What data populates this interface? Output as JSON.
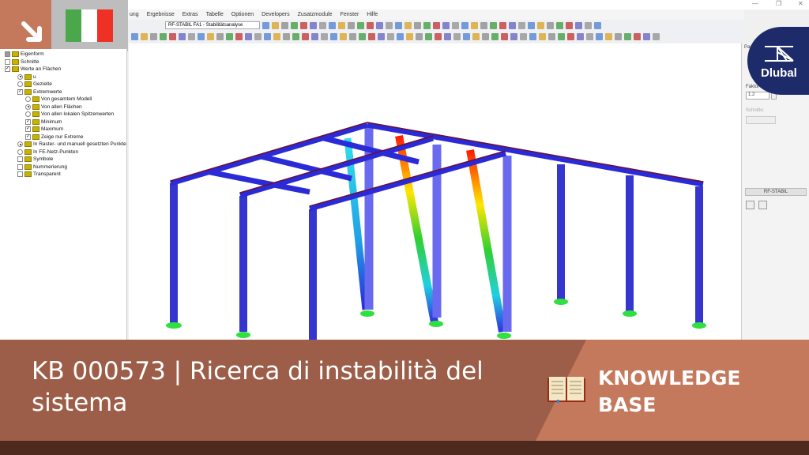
{
  "menu": [
    "ung",
    "Ergebnisse",
    "Extras",
    "Tabelle",
    "Optionen",
    "Developers",
    "Zusatzmodule",
    "Fenster",
    "Hilfe"
  ],
  "toolbar": {
    "case_select": "RF-STABIL FA1 - Stabilitätsanalyse"
  },
  "tree": [
    {
      "label": "Eigenform",
      "type": "cb",
      "state": "partial",
      "level": 0
    },
    {
      "label": "Schnitte",
      "type": "cb",
      "state": "off",
      "level": 0
    },
    {
      "label": "Werte an Flächen",
      "type": "cb",
      "state": "on",
      "level": 0
    },
    {
      "label": "u",
      "type": "rd",
      "state": "on",
      "level": 1
    },
    {
      "label": "Gezielte",
      "type": "rd",
      "state": "off",
      "level": 1
    },
    {
      "label": "Extremwerte",
      "type": "cb",
      "state": "on",
      "level": 1
    },
    {
      "label": "Von gesamtem Modell",
      "type": "rd",
      "state": "off",
      "level": 2
    },
    {
      "label": "Von allen Flächen",
      "type": "rd",
      "state": "on",
      "level": 2
    },
    {
      "label": "Von allen lokalen Spitzenwerten",
      "type": "rd",
      "state": "off",
      "level": 2
    },
    {
      "label": "Minimum",
      "type": "cb",
      "state": "on",
      "level": 2
    },
    {
      "label": "Maximum",
      "type": "cb",
      "state": "on",
      "level": 2
    },
    {
      "label": "Zeige nur Extreme",
      "type": "cb",
      "state": "on",
      "level": 2
    },
    {
      "label": "In Raster- und manuell gesetzten Punkte",
      "type": "rd",
      "state": "on",
      "level": 1
    },
    {
      "label": "In FE-Netz-Punkten",
      "type": "rd",
      "state": "off",
      "level": 1
    },
    {
      "label": "Symbole",
      "type": "cb",
      "state": "off",
      "level": 1
    },
    {
      "label": "Nummerierung",
      "type": "cb",
      "state": "off",
      "level": 1
    },
    {
      "label": "Transparent",
      "type": "cb",
      "state": "off",
      "level": 1
    }
  ],
  "panel": {
    "tab": "Par",
    "faktor_label": "Faktor",
    "faktor_value": "1.2",
    "schnitte_label": "Schnitte:",
    "module_button": "RF-STABIL"
  },
  "logo": {
    "text": "Dlubal"
  },
  "banner": {
    "title": "KB 000573 | Ricerca di instabilità del sistema",
    "category_line1": "KNOWLEDGE",
    "category_line2": "BASE"
  },
  "colors": {
    "accent": "#c4785c",
    "banner_dark": "#9c5e48",
    "footer": "#4e2a1e",
    "logo": "#1d2b6b"
  }
}
